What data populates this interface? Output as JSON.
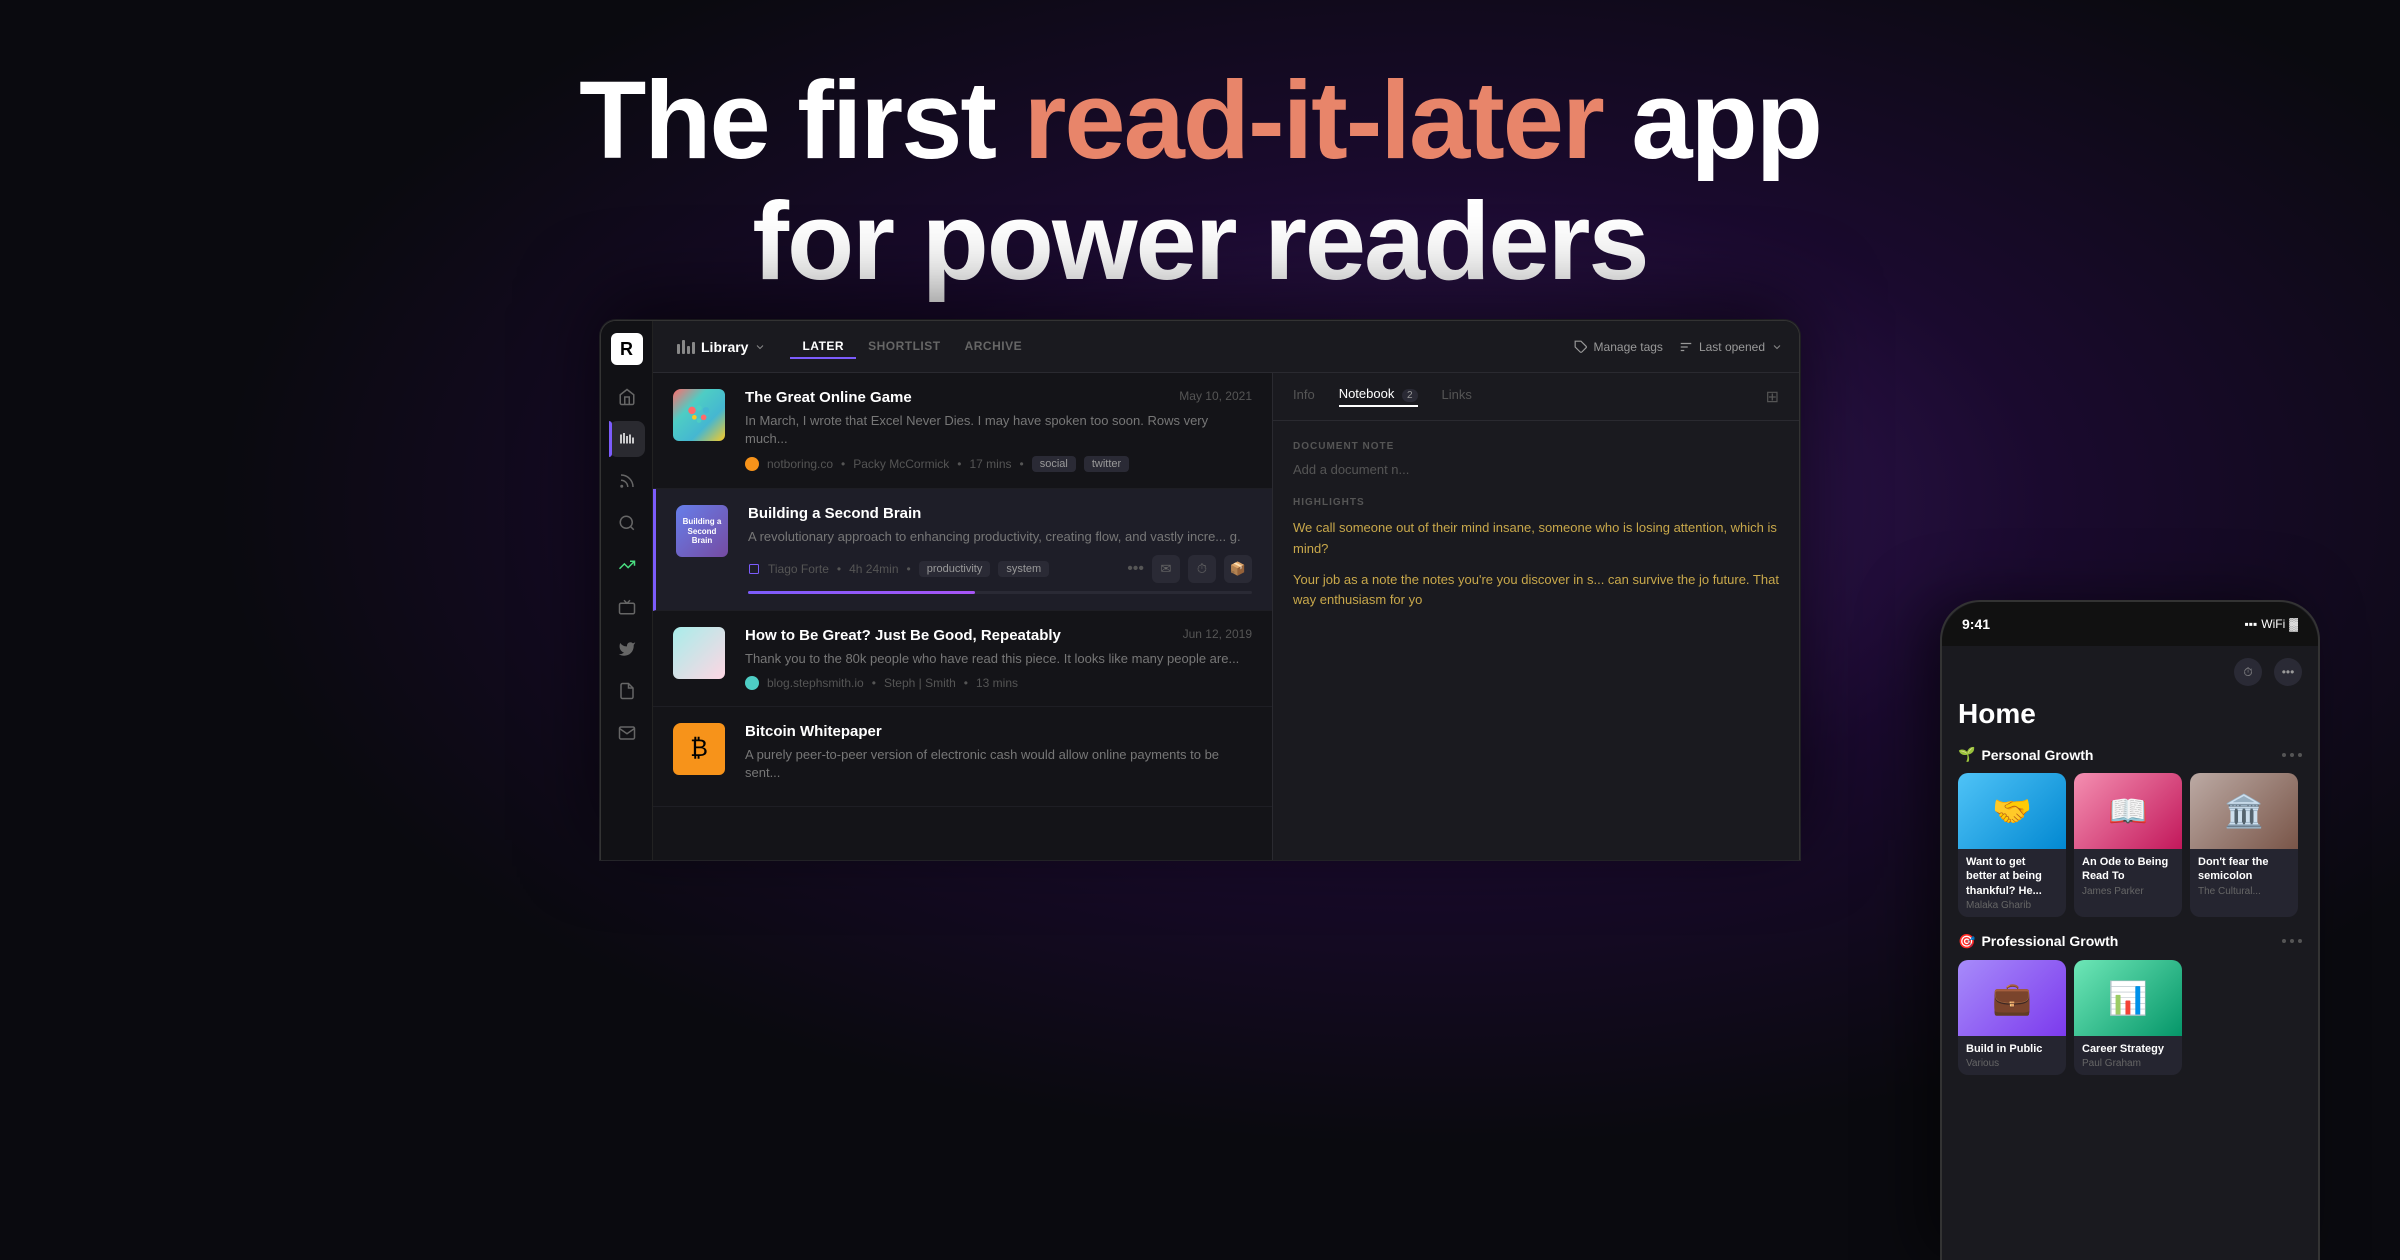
{
  "hero": {
    "line1_pre": "The first ",
    "line1_accent": "read-it-later",
    "line1_post": " app",
    "line2": "for power readers"
  },
  "app": {
    "logo": "R",
    "toolbar": {
      "library_label": "Library",
      "tabs": [
        "LATER",
        "SHORTLIST",
        "ARCHIVE"
      ],
      "active_tab": "LATER",
      "manage_tags": "Manage tags",
      "sort_label": "Last opened"
    },
    "sidebar_icons": [
      "home",
      "library",
      "feed",
      "search",
      "grow",
      "box",
      "twitter",
      "doc",
      "mail"
    ],
    "articles": [
      {
        "title": "The Great Online Game",
        "date": "May 10, 2021",
        "excerpt": "In March, I wrote that Excel Never Dies. I may have spoken too soon. Rows very much...",
        "source": "notboring.co",
        "author": "Packy McCormick",
        "read_time": "17 mins",
        "tags": [
          "social",
          "twitter"
        ],
        "source_color": "#f7931a",
        "has_dot": true
      },
      {
        "title": "Building a Second Brain",
        "date": "",
        "excerpt": "A revolutionary approach to enhancing productivity, creating flow, and vastly incre... g.",
        "source": "Tiago Forte",
        "author": "",
        "read_time": "4h 24min",
        "tags": [
          "productivity",
          "system"
        ],
        "source_color": "#7c5cfc",
        "has_dot": false,
        "progress": 45,
        "selected": true
      },
      {
        "title": "How to Be Great? Just Be Good, Repeatably",
        "date": "Jun 12, 2019",
        "excerpt": "Thank you to the 80k people who have read this piece. It looks like many people are...",
        "source": "blog.stephsmith.io",
        "author": "Steph | Smith",
        "read_time": "13 mins",
        "source_color": "#4ecdc4",
        "tags": [],
        "has_dot": true
      },
      {
        "title": "Bitcoin Whitepaper",
        "date": "",
        "excerpt": "A purely peer-to-peer version of electronic cash would allow online payments to be sent...",
        "source": "",
        "author": "",
        "read_time": "",
        "source_color": "#f7931a",
        "tags": [],
        "has_dot": false
      }
    ],
    "detail": {
      "tabs": [
        "Info",
        "Notebook",
        "Links"
      ],
      "notebook_count": "2",
      "active_tab": "Notebook",
      "section_label": "DOCUMENT NOTE",
      "doc_note_placeholder": "Add a document n...",
      "highlights_label": "HIGHLIGHTS",
      "highlights": [
        "We call someone out of their mind insane, someone who is losing attention, which is mind?",
        "Your job as a note the notes you're you discover in s... can survive the jo future. That way enthusiasm for yo"
      ]
    }
  },
  "mobile": {
    "time": "9:41",
    "home_title": "Home",
    "sections": [
      {
        "title": "Personal Growth",
        "emoji": "🌱",
        "cards": [
          {
            "title": "Want to get better at being thankful? He...",
            "author": "Malaka Gharib",
            "bg": "blue"
          },
          {
            "title": "An Ode to Being Read To",
            "author": "James Parker",
            "bg": "pink"
          },
          {
            "title": "Don't fear the semicolon",
            "author": "The Cultural...",
            "bg": "bust"
          }
        ]
      },
      {
        "title": "Professional Growth",
        "emoji": "🎯",
        "cards": []
      }
    ]
  }
}
